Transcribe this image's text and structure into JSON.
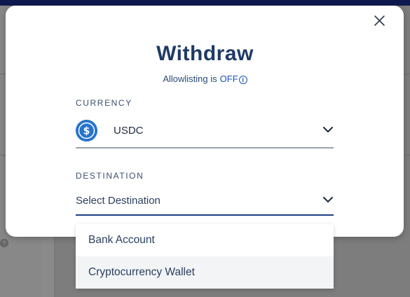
{
  "modal": {
    "title": "Withdraw",
    "allowlisting_label": "Allowlisting is",
    "allowlisting_status": "OFF",
    "close_icon": "close-icon"
  },
  "currency": {
    "label": "CURRENCY",
    "value": "USDC",
    "icon": "usdc-coin-icon",
    "coin_color": "#2775ca"
  },
  "destination": {
    "label": "DESTINATION",
    "value": "Select Destination",
    "options": [
      "Bank Account",
      "Cryptocurrency Wallet"
    ]
  },
  "colors": {
    "title": "#1f3a66",
    "accent": "#1c3f86",
    "topbar": "#0e1a4f"
  }
}
